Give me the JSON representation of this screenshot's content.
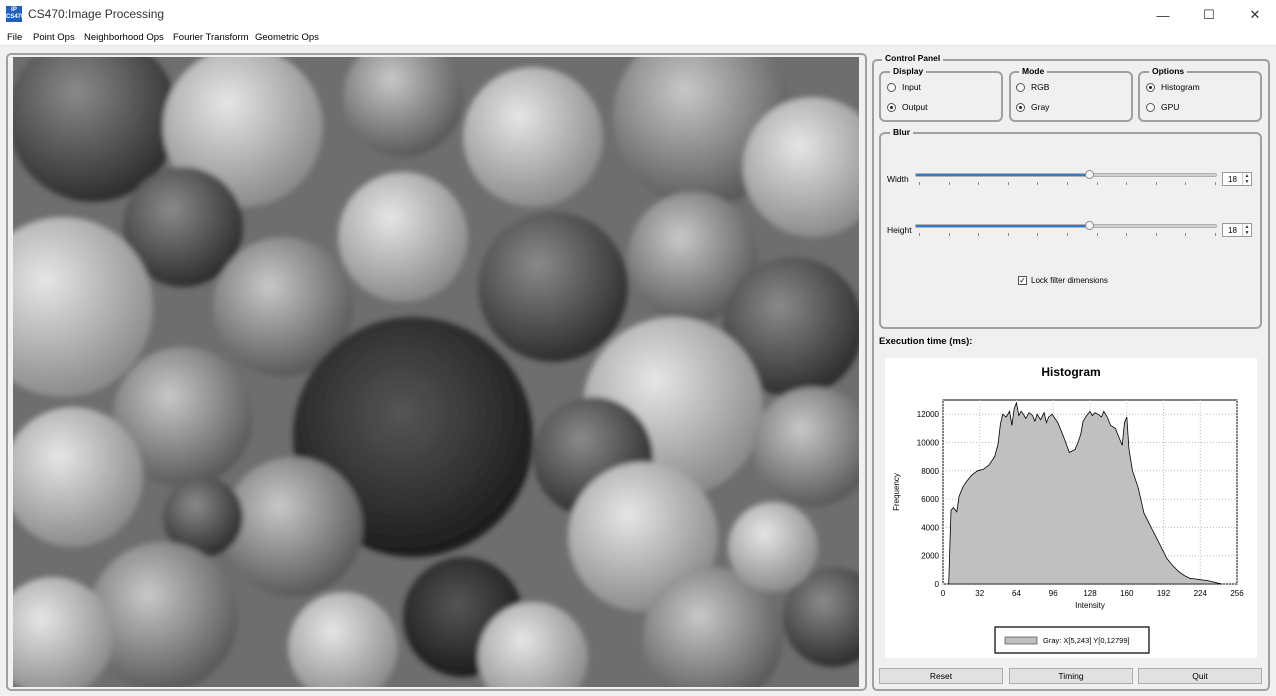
{
  "window": {
    "title": "CS470:Image Processing",
    "icon_text": "IP CS470",
    "controls": {
      "minimize": "—",
      "maximize": "☐",
      "close": "✕"
    }
  },
  "menu": [
    "File",
    "Point Ops",
    "Neighborhood Ops",
    "Fourier Transform",
    "Geometric Ops"
  ],
  "control_panel": {
    "title": "Control Panel",
    "display": {
      "title": "Display",
      "options": [
        "Input",
        "Output"
      ],
      "selected": "Output"
    },
    "mode": {
      "title": "Mode",
      "options": [
        "RGB",
        "Gray"
      ],
      "selected": "Gray"
    },
    "options": {
      "title": "Options",
      "items": [
        "Histogram",
        "GPU"
      ],
      "selected": "Histogram"
    },
    "blur": {
      "title": "Blur",
      "width_label": "Width",
      "width_value": "18",
      "height_label": "Height",
      "height_value": "18",
      "slider_fraction": 0.58,
      "lock_label": "Lock filter dimensions",
      "lock_checked": true
    },
    "exec_label": "Execution time (ms):"
  },
  "chart_data": {
    "type": "area",
    "title": "Histogram",
    "xlabel": "Intensity",
    "ylabel": "Frequency",
    "xlim": [
      0,
      256
    ],
    "ylim": [
      0,
      13000
    ],
    "xticks": [
      0,
      32,
      64,
      96,
      128,
      160,
      192,
      224,
      256
    ],
    "yticks": [
      0,
      2000,
      4000,
      6000,
      8000,
      10000,
      12000
    ],
    "grid": true,
    "legend": "bottom-center",
    "series": [
      {
        "name": "Gray: X[5,243] Y[0,12799]",
        "color": "#c0c0c0",
        "x": [
          5,
          7,
          9,
          12,
          14,
          17,
          20,
          25,
          30,
          35,
          40,
          45,
          48,
          50,
          52,
          55,
          58,
          60,
          62,
          64,
          66,
          68,
          70,
          72,
          75,
          78,
          80,
          82,
          85,
          88,
          90,
          92,
          95,
          100,
          105,
          110,
          115,
          118,
          120,
          122,
          125,
          128,
          130,
          132,
          135,
          138,
          140,
          143,
          146,
          150,
          154,
          156,
          158,
          160,
          162,
          165,
          170,
          175,
          180,
          185,
          190,
          195,
          200,
          205,
          210,
          215,
          220,
          225,
          230,
          235,
          240,
          243
        ],
        "y": [
          0,
          5200,
          5400,
          5100,
          6200,
          6800,
          7200,
          7700,
          8000,
          8100,
          8400,
          9000,
          9900,
          11300,
          12000,
          11800,
          12200,
          11200,
          12400,
          12799,
          11900,
          12200,
          12000,
          11700,
          12100,
          11900,
          11500,
          12000,
          11600,
          12100,
          11400,
          11800,
          12000,
          11400,
          10400,
          9300,
          9500,
          10100,
          10600,
          11500,
          11900,
          12200,
          11900,
          12100,
          12000,
          11800,
          12200,
          11800,
          11200,
          11000,
          10200,
          9800,
          11400,
          11800,
          9500,
          8000,
          6800,
          5000,
          4200,
          3400,
          2600,
          1800,
          1300,
          900,
          600,
          400,
          350,
          300,
          250,
          150,
          50,
          0
        ]
      }
    ]
  },
  "buttons": {
    "reset": "Reset",
    "timing": "Timing",
    "quit": "Quit"
  }
}
